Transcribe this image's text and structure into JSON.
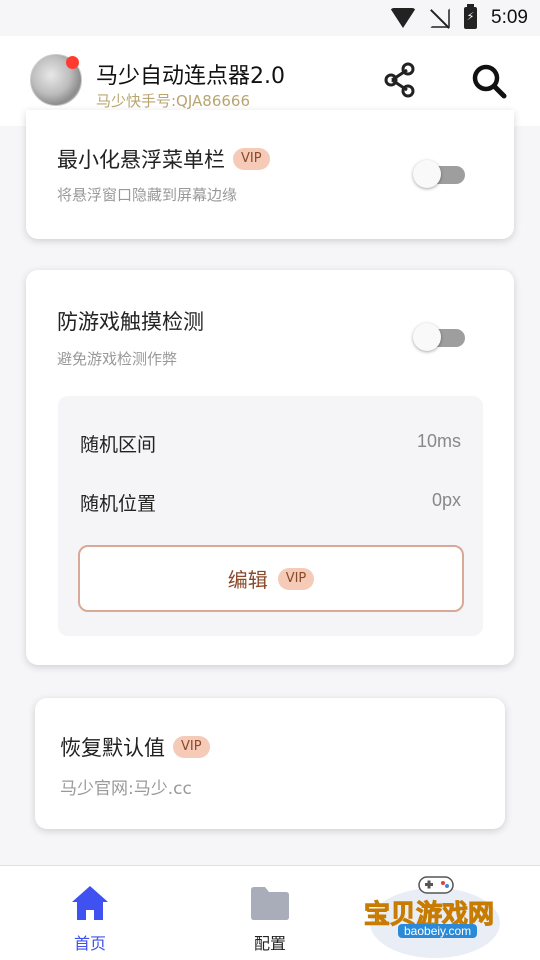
{
  "status_bar": {
    "time": "5:09",
    "icons": [
      "wifi-icon",
      "no-signal-icon",
      "battery-charging-icon"
    ]
  },
  "header": {
    "title": "马少自动连点器2.0",
    "subtitle": "马少快手号:QJA86666",
    "actions": [
      "share-icon",
      "search-icon"
    ]
  },
  "cards": {
    "minimize": {
      "title": "最小化悬浮菜单栏",
      "badge": "VIP",
      "desc": "将悬浮窗口隐藏到屏幕边缘",
      "toggle_on": false
    },
    "anti_detect": {
      "title": "防游戏触摸检测",
      "desc": "避免游戏检测作弊",
      "toggle_on": false,
      "rows": [
        {
          "label": "随机区间",
          "value": "10ms"
        },
        {
          "label": "随机位置",
          "value": "0px"
        }
      ],
      "edit_label": "编辑",
      "edit_badge": "VIP"
    },
    "restore": {
      "title": "恢复默认值",
      "badge": "VIP",
      "desc": "马少官网:马少.cc"
    }
  },
  "bottom_nav": {
    "items": [
      {
        "label": "首页",
        "icon": "home-icon",
        "active": true
      },
      {
        "label": "配置",
        "icon": "folder-icon",
        "active": false
      }
    ]
  },
  "watermark": {
    "text": "宝贝游戏网",
    "url": "baobeiy.com"
  },
  "colors": {
    "accent": "#3f51f0",
    "vip_bg": "#f5cbb8",
    "vip_text": "#8a4a2a",
    "subtitle_gold": "#b9a572"
  }
}
